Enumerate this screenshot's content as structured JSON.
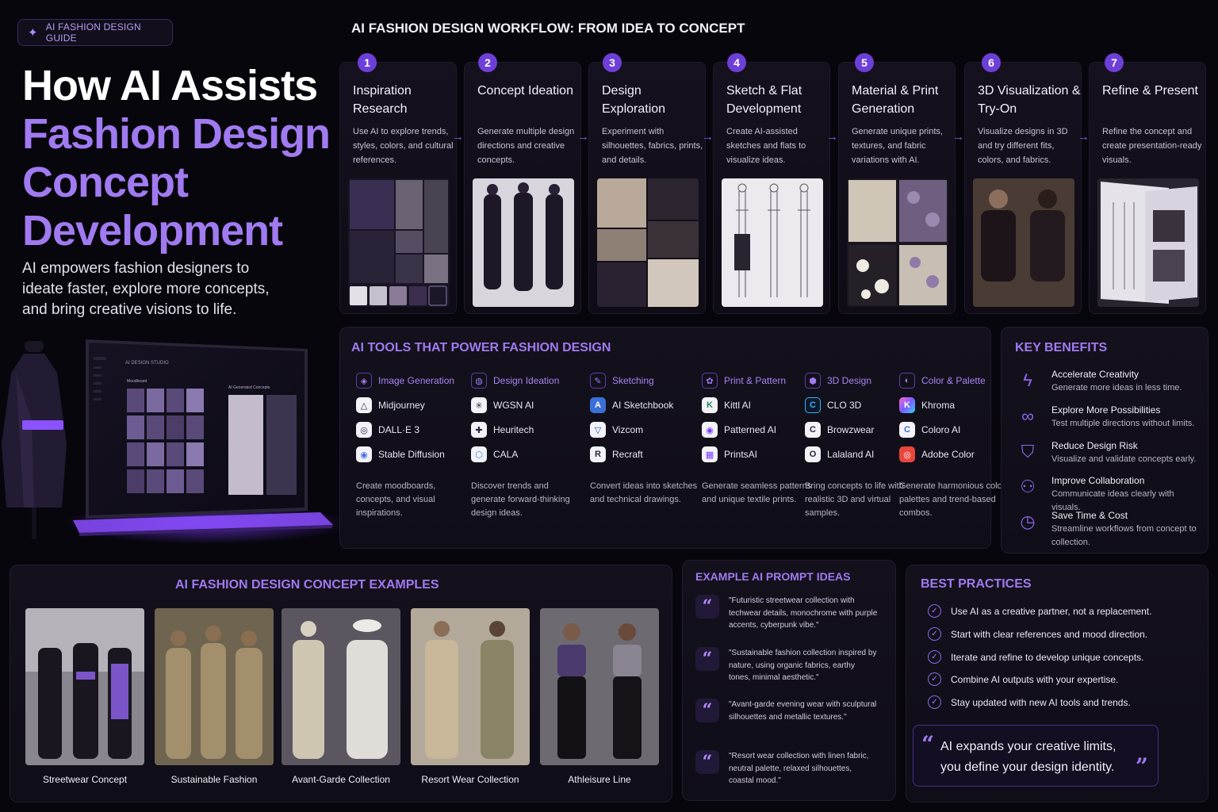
{
  "badge": {
    "label": "AI FASHION DESIGN GUIDE"
  },
  "hero": {
    "title_line1": "How AI Assists",
    "title_line2": "Fashion Design",
    "title_line3": "Concept",
    "title_line4": "Development",
    "subtitle": "AI empowers fashion designers to ideate faster, explore more concepts, and bring creative visions to life."
  },
  "illustration": {
    "screen_title": "AI DESIGN STUDIO",
    "moodboard": "Moodboard",
    "generated": "AI Generated Concepts"
  },
  "workflow": {
    "title": "AI FASHION DESIGN WORKFLOW: FROM IDEA TO CONCEPT",
    "steps": [
      {
        "num": "1",
        "title": "Inspiration Research",
        "desc": "Use AI to explore trends, styles, colors, and cultural references."
      },
      {
        "num": "2",
        "title": "Concept Ideation",
        "desc": "Generate multiple design directions and creative concepts."
      },
      {
        "num": "3",
        "title": "Design Exploration",
        "desc": "Experiment with silhouettes, fabrics, prints, and details."
      },
      {
        "num": "4",
        "title": "Sketch & Flat Development",
        "desc": "Create AI-assisted sketches and flats to visualize ideas."
      },
      {
        "num": "5",
        "title": "Material & Print Generation",
        "desc": "Generate unique prints, textures, and fabric variations with AI."
      },
      {
        "num": "6",
        "title": "3D Visualization & Try-On",
        "desc": "Visualize designs in 3D and try different fits, colors, and fabrics."
      },
      {
        "num": "7",
        "title": "Refine & Present",
        "desc": "Refine the concept and create presentation-ready visuals."
      }
    ]
  },
  "tools": {
    "title": "AI TOOLS THAT POWER FASHION DESIGN",
    "columns": [
      {
        "heading": "Image Generation",
        "items": [
          "Midjourney",
          "DALL·E 3",
          "Stable Diffusion"
        ],
        "desc": "Create moodboards, concepts, and visual inspirations."
      },
      {
        "heading": "Design Ideation",
        "items": [
          "WGSN AI",
          "Heuritech",
          "CALA"
        ],
        "desc": "Discover trends and generate forward-thinking design ideas."
      },
      {
        "heading": "Sketching",
        "items": [
          "AI Sketchbook",
          "Vizcom",
          "Recraft"
        ],
        "desc": "Convert ideas into sketches and technical drawings."
      },
      {
        "heading": "Print & Pattern",
        "items": [
          "Kittl AI",
          "Patterned AI",
          "PrintsAI"
        ],
        "desc": "Generate seamless patterns and unique textile prints."
      },
      {
        "heading": "3D Design",
        "items": [
          "CLO 3D",
          "Browzwear",
          "Lalaland AI"
        ],
        "desc": "Bring concepts to life with realistic 3D and virtual samples."
      },
      {
        "heading": "Color & Palette",
        "items": [
          "Khroma",
          "Coloro AI",
          "Adobe Color"
        ],
        "desc": "Generate harmonious color palettes and trend-based combos."
      }
    ]
  },
  "benefits": {
    "title": "KEY BENEFITS",
    "items": [
      {
        "title": "Accelerate Creativity",
        "desc": "Generate more ideas in less time."
      },
      {
        "title": "Explore More Possibilities",
        "desc": "Test multiple directions without limits."
      },
      {
        "title": "Reduce Design Risk",
        "desc": "Visualize and validate concepts early."
      },
      {
        "title": "Improve Collaboration",
        "desc": "Communicate ideas clearly with visuals."
      },
      {
        "title": "Save Time & Cost",
        "desc": "Streamline workflows from concept to collection."
      }
    ]
  },
  "examples": {
    "title": "AI FASHION DESIGN CONCEPT EXAMPLES",
    "items": [
      "Streetwear Concept",
      "Sustainable Fashion",
      "Avant-Garde Collection",
      "Resort Wear Collection",
      "Athleisure Line"
    ]
  },
  "prompts": {
    "title": "EXAMPLE AI PROMPT IDEAS",
    "items": [
      "\"Futuristic streetwear collection with techwear details, monochrome with purple accents, cyberpunk vibe.\"",
      "\"Sustainable fashion collection inspired by nature, using organic fabrics, earthy tones, minimal aesthetic.\"",
      "\"Avant-garde evening wear with sculptural silhouettes and metallic textures.\"",
      "\"Resort wear collection with linen fabric, neutral palette, relaxed silhouettes, coastal mood.\""
    ]
  },
  "best_practices": {
    "title": "BEST PRACTICES",
    "items": [
      "Use AI as a creative partner, not a replacement.",
      "Start with clear references and mood direction.",
      "Iterate and refine to develop unique concepts.",
      "Combine AI outputs with your expertise.",
      "Stay updated with new AI tools and trends."
    ],
    "quote": "AI expands your creative limits, you define your design identity."
  },
  "colors": {
    "accent": "#a07af0",
    "background": "#07060c",
    "panel": "#14111d"
  }
}
